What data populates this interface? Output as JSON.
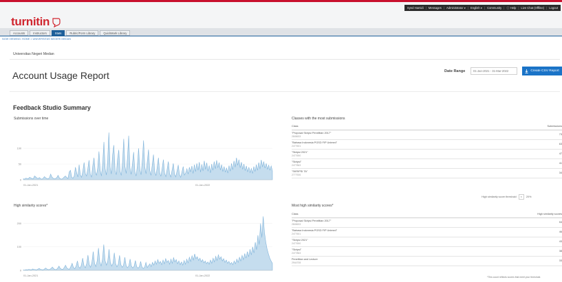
{
  "brand": {
    "name": "turnitin",
    "color": "#d0262f"
  },
  "topnav": {
    "items": [
      "Syed Hamidi",
      "Messages",
      "Administrator ▾",
      "English ▾",
      "Community",
      "ⓘ Help",
      "Live Chat (Offline)",
      "Logout"
    ]
  },
  "tabs": [
    {
      "label": "Accounts",
      "active": false
    },
    {
      "label": "Instructors",
      "active": false
    },
    {
      "label": "Stats",
      "active": true
    },
    {
      "label": "Rubric/Form Library",
      "active": false
    },
    {
      "label": "QuickMark Library",
      "active": false
    }
  ],
  "breadcrumb": "NOW VIEWING: HOME > UNIVERSITAS NEGERI MEDAN",
  "institution": "Universitas Negeri Medan",
  "page_title": "Account Usage Report",
  "date_range": {
    "label": "Date Range",
    "value": "01-Jan-2021 - 31-Mar-2022"
  },
  "csv_button": {
    "label": "Create CSV Report",
    "icon": "download-icon"
  },
  "section_title": "Feedback Studio Summary",
  "charts_text": {
    "submissions_title": "Submissions over time",
    "similarity_title": "High similarity scores*"
  },
  "chart_data": [
    {
      "type": "area",
      "title": "Submissions over time",
      "x_tick_labels": [
        "01-Jan-2021",
        "01-Jan-2022"
      ],
      "y_tick_labels": [
        "0",
        "50",
        "100"
      ],
      "ylim": [
        0,
        170
      ],
      "color": "#7fb3da",
      "series": [
        {
          "values": [
            3,
            2,
            5,
            4,
            3,
            8,
            6,
            4,
            3,
            12,
            9,
            5,
            4,
            7,
            3,
            2,
            5,
            10,
            6,
            4,
            3,
            6,
            18,
            9,
            5,
            3,
            4,
            7,
            14,
            6,
            3,
            2,
            5,
            9,
            12,
            7,
            4,
            25,
            30,
            8,
            5,
            11,
            40,
            22,
            9,
            48,
            15,
            8,
            28,
            55,
            20,
            12,
            35,
            62,
            18,
            9,
            44,
            70,
            25,
            14,
            38,
            90,
            30,
            12,
            52,
            120,
            35,
            15,
            60,
            150,
            40,
            18,
            78,
            110,
            30,
            16,
            66,
            95,
            28,
            14,
            55,
            130,
            42,
            20,
            70,
            140,
            38,
            17,
            50,
            88,
            25,
            12,
            45,
            100,
            33,
            16,
            62,
            125,
            40,
            19,
            58,
            96,
            30,
            14,
            47,
            80,
            26,
            13,
            40,
            70,
            22,
            11,
            36,
            64,
            20,
            10,
            33,
            58,
            19,
            9,
            30,
            52,
            18,
            9,
            28,
            47,
            16,
            8,
            25,
            42,
            15,
            22,
            35,
            18,
            40,
            25,
            44,
            20,
            48,
            26,
            52,
            30,
            56,
            24,
            49,
            28,
            60,
            33,
            54,
            27,
            45,
            22,
            50,
            30,
            58,
            35,
            62,
            38,
            55,
            31,
            48,
            26,
            42,
            24,
            38,
            21,
            45,
            27,
            52,
            32,
            60,
            40,
            70,
            46,
            64,
            38,
            56,
            33,
            50,
            29,
            44,
            25,
            40,
            23,
            36,
            20,
            42,
            26,
            48,
            30,
            55,
            34,
            63,
            41,
            58,
            37,
            52,
            33,
            47,
            30,
            44,
            28
          ]
        }
      ]
    },
    {
      "type": "area",
      "title": "High similarity scores*",
      "x_tick_labels": [
        "01-Jan-2021",
        "01-Jan-2022"
      ],
      "y_tick_labels": [
        "0",
        "100",
        "200"
      ],
      "ylim": [
        0,
        240
      ],
      "color": "#7fb3da",
      "series": [
        {
          "values": [
            2,
            1,
            3,
            2,
            4,
            3,
            2,
            6,
            4,
            3,
            2,
            5,
            8,
            4,
            3,
            2,
            6,
            10,
            5,
            3,
            4,
            8,
            14,
            7,
            4,
            3,
            9,
            18,
            8,
            5,
            4,
            12,
            22,
            10,
            6,
            5,
            16,
            30,
            12,
            7,
            18,
            40,
            15,
            9,
            22,
            52,
            20,
            11,
            28,
            65,
            24,
            13,
            34,
            80,
            30,
            16,
            40,
            95,
            36,
            19,
            46,
            110,
            42,
            22,
            38,
            90,
            34,
            18,
            30,
            75,
            28,
            15,
            26,
            64,
            24,
            13,
            22,
            56,
            20,
            11,
            19,
            48,
            18,
            10,
            17,
            42,
            16,
            9,
            15,
            38,
            14,
            8,
            13,
            34,
            12,
            20,
            28,
            16,
            34,
            22,
            40,
            26,
            46,
            30,
            38,
            24,
            44,
            28,
            50,
            34,
            42,
            26,
            48,
            30,
            54,
            36,
            46,
            28,
            40,
            24,
            36,
            22,
            42,
            26,
            48,
            32,
            56,
            38,
            62,
            44,
            70,
            50,
            58,
            42,
            52,
            36,
            46,
            32,
            40,
            28,
            36,
            26,
            44,
            30,
            52,
            36,
            60,
            42,
            66,
            48,
            58,
            40,
            50,
            34,
            44,
            30,
            38,
            26,
            34,
            24,
            40,
            28,
            48,
            34,
            56,
            40,
            64,
            46,
            72,
            52,
            80,
            58,
            90,
            66,
            100,
            74,
            120,
            88,
            150,
            110,
            200,
            140,
            230,
            160,
            120,
            90,
            70,
            52,
            40,
            30
          ]
        }
      ]
    }
  ],
  "top_classes": {
    "title": "Classes with the most submissions",
    "col_class": "Class",
    "col_value": "Submissions",
    "rows": [
      {
        "name": "\"Proposal Skripsi Penelitian 2017\"",
        "id": "2845633",
        "value": "73"
      },
      {
        "name": "\"Bahasa Indonesia PGSD FIP Unimed\"",
        "id": "2477601",
        "value": "63"
      },
      {
        "name": "\"Skripsi 2021\"",
        "id": "2477690",
        "value": "47"
      },
      {
        "name": "\"Skripsi\"",
        "id": "2477863",
        "value": "41"
      },
      {
        "name": "\"SKRIPSI TA\"",
        "id": "2777926",
        "value": "34"
      }
    ]
  },
  "threshold": {
    "label": "High similarity score threshold",
    "value": "20%"
  },
  "top_similarity": {
    "title": "Most high similarity scores*",
    "col_class": "Class",
    "col_value": "High similarity scores",
    "rows": [
      {
        "name": "\"Proposal Skripsi Penelitian 2017\"",
        "id": "2845633",
        "value": "53"
      },
      {
        "name": "\"Bahasa Indonesia PGSD FIP Unimed\"",
        "id": "2477601",
        "value": "46"
      },
      {
        "name": "\"Skripsi 2021\"",
        "id": "2477690",
        "value": "43"
      },
      {
        "name": "\"Skripsi\"",
        "id": "2477863",
        "value": "38"
      },
      {
        "name": "Penelitian and Lecture",
        "id": "2944708",
        "value": "33"
      }
    ]
  },
  "footnote": "*This count reflects scores that meet your threshold."
}
